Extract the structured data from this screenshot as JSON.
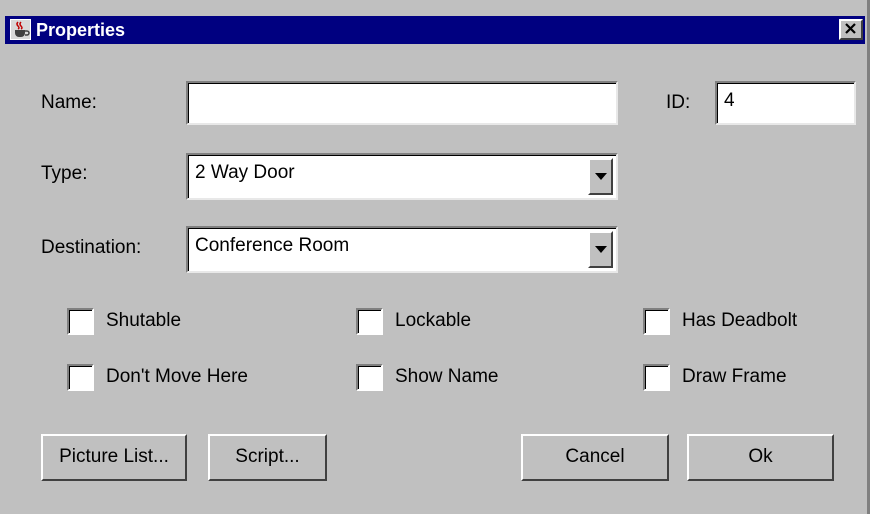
{
  "window": {
    "title": "Properties",
    "app_icon": "java-cup-icon",
    "close_icon": "close-x-icon"
  },
  "form": {
    "name_label": "Name:",
    "name_value": "",
    "id_label": "ID:",
    "id_value": "4",
    "type_label": "Type:",
    "type_value": "2 Way Door",
    "destination_label": "Destination:",
    "destination_value": "Conference Room"
  },
  "checkboxes": {
    "shutable": {
      "label": "Shutable",
      "checked": false
    },
    "lockable": {
      "label": "Lockable",
      "checked": false
    },
    "has_deadbolt": {
      "label": "Has Deadbolt",
      "checked": false
    },
    "dont_move_here": {
      "label": "Don't Move Here",
      "checked": false
    },
    "show_name": {
      "label": "Show Name",
      "checked": false
    },
    "draw_frame": {
      "label": "Draw Frame",
      "checked": false
    }
  },
  "buttons": {
    "picture_list": "Picture List...",
    "script": "Script...",
    "cancel": "Cancel",
    "ok": "Ok"
  },
  "colors": {
    "title_bar": "#000080",
    "face": "#c0c0c0"
  }
}
